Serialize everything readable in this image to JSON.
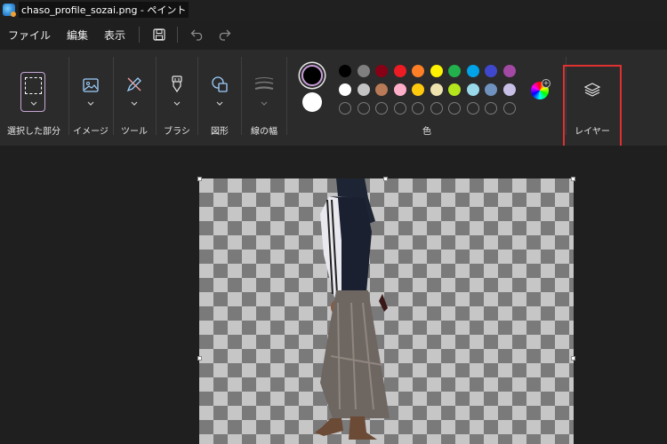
{
  "window": {
    "title": "chaso_profile_sozai.png - ペイント"
  },
  "menu": {
    "file": "ファイル",
    "edit": "編集",
    "view": "表示",
    "icons": [
      "save-icon",
      "undo-icon",
      "redo-icon"
    ]
  },
  "ribbon": {
    "selection": "選択した部分",
    "image": "イメージ",
    "tools": "ツール",
    "brushes": "ブラシ",
    "shapes": "図形",
    "size": "線の幅",
    "colors": "色",
    "layers": "レイヤー"
  },
  "colors": {
    "primary": "#000000",
    "secondary": "#ffffff",
    "row1": [
      "#000000",
      "#7f7f7f",
      "#880015",
      "#ed1c24",
      "#ff7f27",
      "#fff200",
      "#22b14c",
      "#00a2e8",
      "#3f48cc",
      "#a349a4"
    ],
    "row2": [
      "#ffffff",
      "#c3c3c3",
      "#b97a57",
      "#ffaec9",
      "#ffc90e",
      "#efe4b0",
      "#b5e61d",
      "#99d9ea",
      "#7092be",
      "#c8bfe7"
    ],
    "row3_empty_count": 10,
    "highlight": "#e03030",
    "accent": "#c69bd8"
  }
}
